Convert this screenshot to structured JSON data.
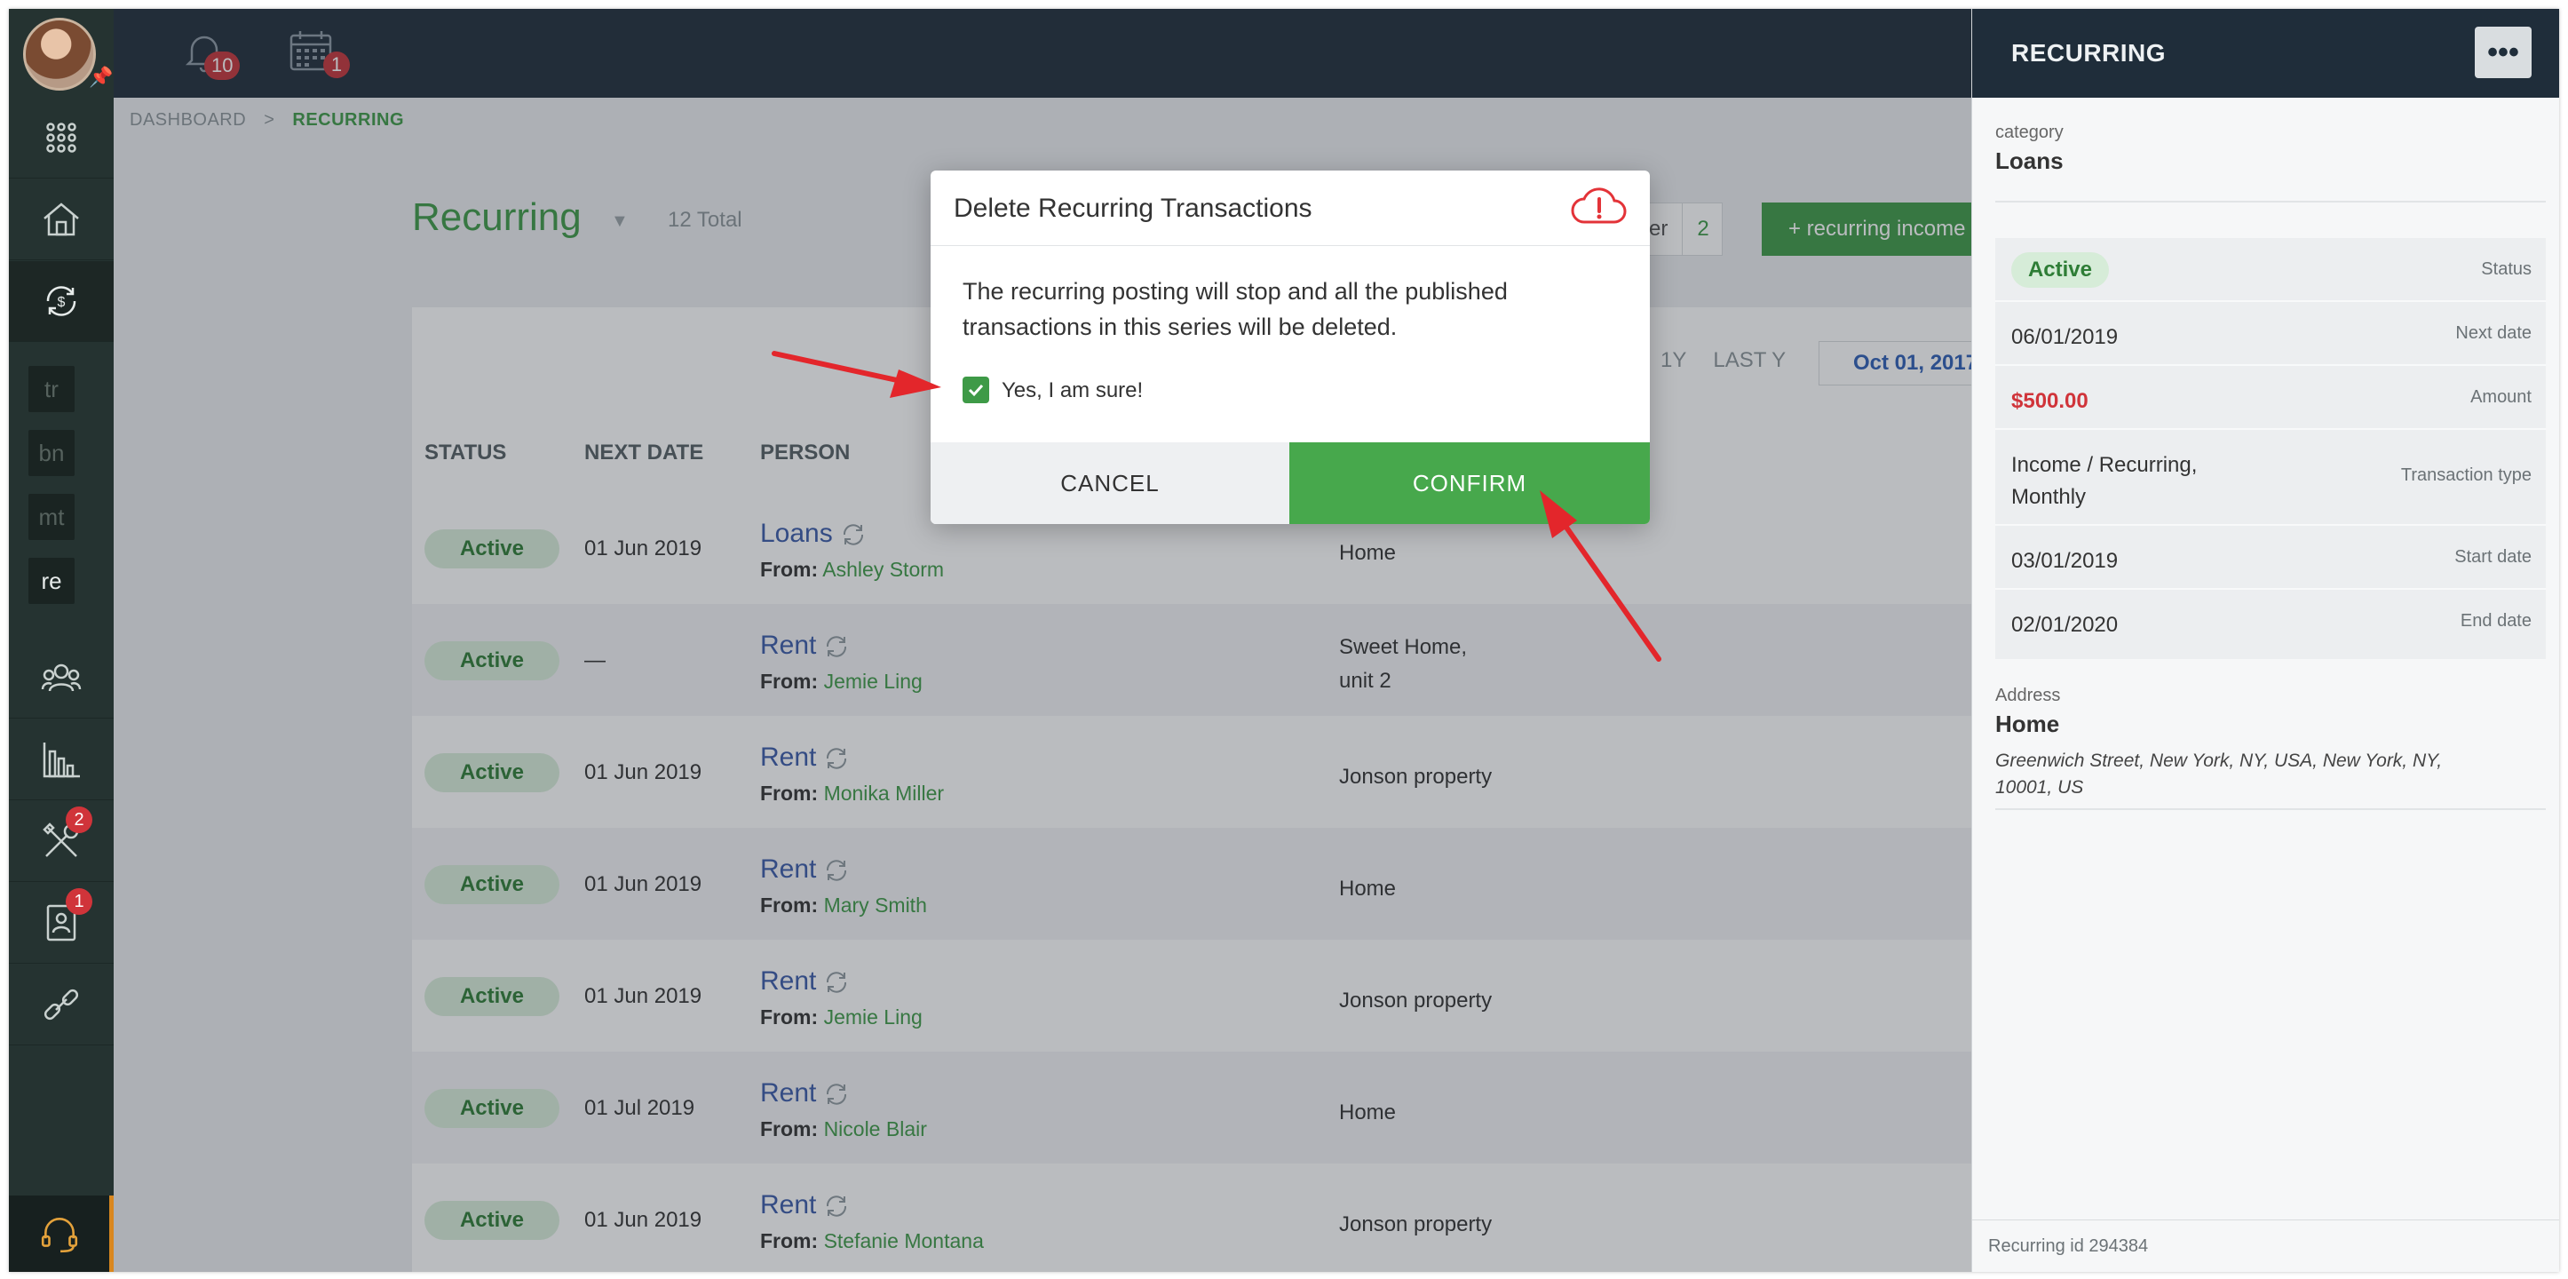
{
  "topbar": {
    "notifications_count": "10",
    "calendar_count": "1"
  },
  "sidebar": {
    "tags": [
      "tr",
      "bn",
      "mt",
      "re"
    ],
    "tools_badge": "2",
    "contacts_badge": "1"
  },
  "breadcrumb": {
    "root": "DASHBOARD",
    "current": "RECURRING"
  },
  "page": {
    "title": "Recurring",
    "total": "12 Total",
    "filter_label": "lter",
    "filter_count": "2",
    "add_button": "+ recurring income",
    "ranges": [
      "1Y",
      "LAST Y"
    ],
    "date_start": "Oct 01, 2017"
  },
  "table": {
    "headers": {
      "status": "STATUS",
      "next_date": "NEXT DATE",
      "person": "PERSON"
    },
    "from_prefix": "From:",
    "rows": [
      {
        "status": "Active",
        "date": "01 Jun 2019",
        "category": "Loans",
        "from": "Ashley Storm",
        "property": "Home"
      },
      {
        "status": "Active",
        "date": "—",
        "category": "Rent",
        "from": "Jemie Ling",
        "property": "Sweet Home,",
        "property2": "unit 2"
      },
      {
        "status": "Active",
        "date": "01 Jun 2019",
        "category": "Rent",
        "from": "Monika Miller",
        "property": "Jonson property"
      },
      {
        "status": "Active",
        "date": "01 Jun 2019",
        "category": "Rent",
        "from": "Mary Smith",
        "property": "Home"
      },
      {
        "status": "Active",
        "date": "01 Jun 2019",
        "category": "Rent",
        "from": "Jemie Ling",
        "property": "Jonson property"
      },
      {
        "status": "Active",
        "date": "01 Jul 2019",
        "category": "Rent",
        "from": "Nicole Blair",
        "property": "Home"
      },
      {
        "status": "Active",
        "date": "01 Jun 2019",
        "category": "Rent",
        "from": "Stefanie Montana",
        "property": "Jonson property"
      }
    ]
  },
  "right_panel": {
    "title": "RECURRING",
    "menu_label": "•••",
    "category_label": "category",
    "category_value": "Loans",
    "status_value": "Active",
    "status_label": "Status",
    "next_date_value": "06/01/2019",
    "next_date_label": "Next date",
    "amount_value": "$500.00",
    "amount_label": "Amount",
    "type_value_line1": "Income / Recurring,",
    "type_value_line2": "Monthly",
    "type_label": "Transaction type",
    "start_value": "03/01/2019",
    "start_label": "Start date",
    "end_value": "02/01/2020",
    "end_label": "End date",
    "address_label": "Address",
    "address_name": "Home",
    "address_line1": "Greenwich Street, New York, NY, USA, New York, NY,",
    "address_line2": "10001, US",
    "footer": "Recurring id 294384"
  },
  "modal": {
    "title": "Delete Recurring Transactions",
    "text_line1": "The recurring posting will stop and all the published",
    "text_line2": "transactions in this series will be deleted.",
    "checkbox_label": "Yes, I am sure!",
    "cancel": "CANCEL",
    "confirm": "CONFIRM"
  },
  "colors": {
    "accent_green": "#3e9a47",
    "confirm_green": "#47a84c",
    "link_blue": "#3a5aa8",
    "amount_red": "#d0343a",
    "arrow_red": "#e3262b",
    "dark_nav": "#1f2d3a"
  },
  "icons": [
    "bell-icon",
    "calendar-icon",
    "apps-grid-icon",
    "house-icon",
    "recurring-money-icon",
    "people-icon",
    "reports-icon",
    "tools-icon",
    "contacts-icon",
    "link-icon",
    "headset-icon",
    "cloud-alert-icon",
    "check-icon",
    "sync-icon",
    "pin-icon"
  ]
}
